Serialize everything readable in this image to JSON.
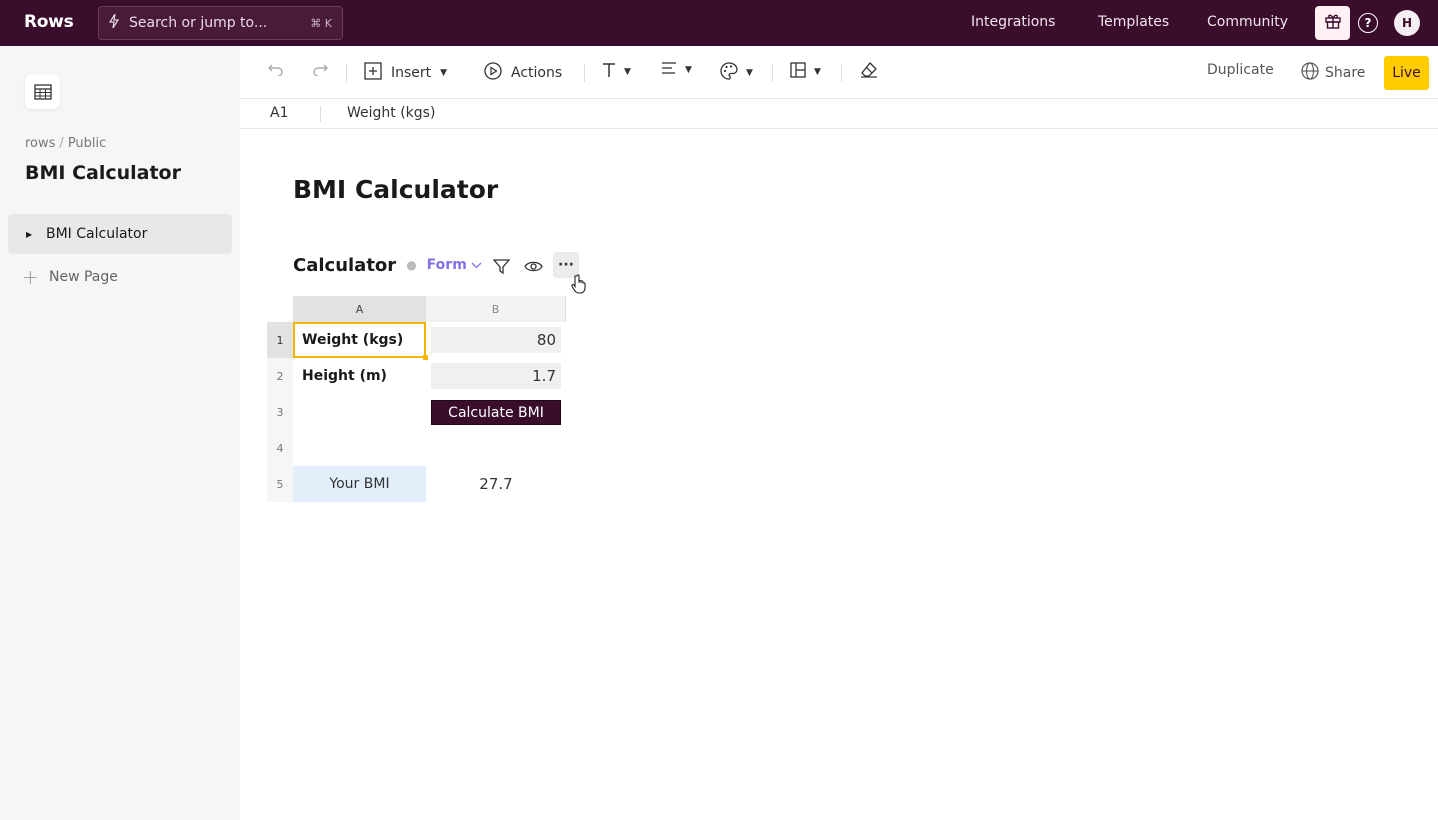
{
  "topbar": {
    "logo": "Rows",
    "search_placeholder": "Search or jump to...",
    "search_shortcut": "⌘ K",
    "links": [
      "Integrations",
      "Templates",
      "Community"
    ],
    "avatar_initial": "H"
  },
  "sidebar": {
    "breadcrumb": [
      "rows",
      "Public"
    ],
    "title": "BMI Calculator",
    "pages": [
      {
        "label": "BMI Calculator"
      }
    ],
    "new_page_label": "New Page"
  },
  "toolbar": {
    "insert_label": "Insert",
    "actions_label": "Actions",
    "duplicate_label": "Duplicate",
    "share_label": "Share",
    "live_label": "Live"
  },
  "formula_bar": {
    "cell_ref": "A1",
    "value": "Weight (kgs)"
  },
  "document": {
    "title": "BMI Calculator"
  },
  "table": {
    "name": "Calculator",
    "view_label": "Form",
    "columns": [
      "A",
      "B"
    ],
    "rows": [
      {
        "num": "1",
        "a": "Weight (kgs)",
        "b": "80"
      },
      {
        "num": "2",
        "a": "Height (m)",
        "b": "1.7"
      },
      {
        "num": "3",
        "a": "",
        "b": "Calculate BMI"
      },
      {
        "num": "4",
        "a": "",
        "b": ""
      },
      {
        "num": "5",
        "a": "Your BMI",
        "b": "27.7"
      }
    ]
  },
  "colors": {
    "brand": "#3b0d2c",
    "live": "#ffcc00",
    "form_accent": "#7f73e6",
    "selection": "#f5b400",
    "result_fill": "#e3eefb"
  }
}
